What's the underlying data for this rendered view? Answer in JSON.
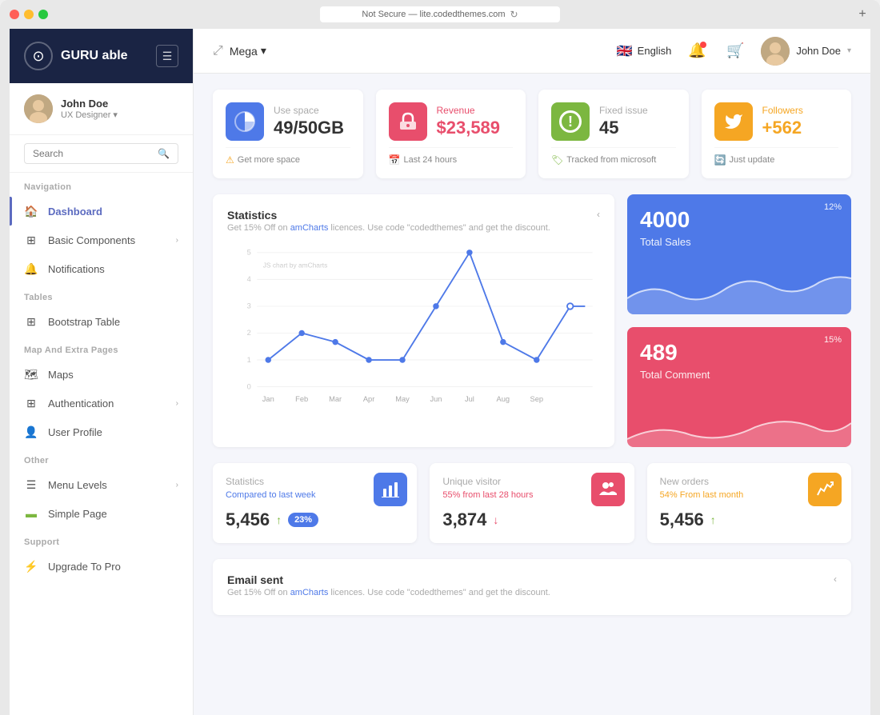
{
  "browser": {
    "url": "Not Secure — lite.codedthemes.com",
    "new_tab_label": "+"
  },
  "sidebar": {
    "logo_text": "GURU able",
    "user_name": "John Doe",
    "user_role": "UX Designer",
    "search_placeholder": "Search",
    "sections": [
      {
        "title": "Navigation",
        "items": [
          {
            "id": "dashboard",
            "label": "Dashboard",
            "icon": "🏠",
            "active": true,
            "has_chevron": false
          },
          {
            "id": "basic-components",
            "label": "Basic Components",
            "icon": "⊞",
            "active": false,
            "has_chevron": true
          },
          {
            "id": "notifications",
            "label": "Notifications",
            "icon": "🔔",
            "active": false,
            "has_chevron": false
          }
        ]
      },
      {
        "title": "Tables",
        "items": [
          {
            "id": "bootstrap-table",
            "label": "Bootstrap Table",
            "icon": "⊞",
            "active": false,
            "has_chevron": false
          }
        ]
      },
      {
        "title": "Map And Extra Pages",
        "items": [
          {
            "id": "maps",
            "label": "Maps",
            "icon": "🗺",
            "active": false,
            "has_chevron": false
          },
          {
            "id": "authentication",
            "label": "Authentication",
            "icon": "⊞",
            "active": false,
            "has_chevron": true
          },
          {
            "id": "user-profile",
            "label": "User Profile",
            "icon": "👤",
            "active": false,
            "has_chevron": false
          }
        ]
      },
      {
        "title": "Other",
        "items": [
          {
            "id": "menu-levels",
            "label": "Menu Levels",
            "icon": "☰",
            "active": false,
            "has_chevron": true
          },
          {
            "id": "simple-page",
            "label": "Simple Page",
            "icon": "▬",
            "active": false,
            "has_chevron": false
          }
        ]
      },
      {
        "title": "Support",
        "items": [
          {
            "id": "upgrade-to-pro",
            "label": "Upgrade To Pro",
            "icon": "⚡",
            "active": false,
            "has_chevron": false
          }
        ]
      }
    ]
  },
  "topbar": {
    "expand_icon": "✕",
    "mega_label": "Mega",
    "language": "English",
    "user_name": "John Doe"
  },
  "stat_cards": [
    {
      "id": "use-space",
      "icon_type": "pie",
      "icon_color": "blue",
      "label": "Use space",
      "value": "49/50GB",
      "value_color": "default",
      "footer_icon": "⚠",
      "footer_text": "Get more space"
    },
    {
      "id": "revenue",
      "icon_type": "home",
      "icon_color": "red",
      "label": "Revenue",
      "value": "$23,589",
      "value_color": "red",
      "footer_icon": "📅",
      "footer_text": "Last 24 hours"
    },
    {
      "id": "fixed-issue",
      "icon_type": "alert",
      "icon_color": "green",
      "label": "Fixed issue",
      "value": "45",
      "value_color": "default",
      "footer_icon": "🏷",
      "footer_text": "Tracked from microsoft"
    },
    {
      "id": "followers",
      "icon_type": "twitter",
      "icon_color": "orange",
      "label": "Followers",
      "value": "+562",
      "value_color": "orange",
      "footer_icon": "🔄",
      "footer_text": "Just update"
    }
  ],
  "statistics_chart": {
    "title": "Statistics",
    "subtitle_prefix": "Get 15% Off on ",
    "subtitle_link": "amCharts",
    "subtitle_suffix": " licences. Use code \"codedthemes\" and get the discount.",
    "collapse_icon": "<",
    "js_chart_label": "JS chart by amCharts",
    "y_labels": [
      "0",
      "1",
      "2",
      "3",
      "4",
      "5"
    ],
    "x_labels": [
      "Jan",
      "Feb",
      "Mar",
      "Apr",
      "May",
      "Jun",
      "Jul",
      "Aug",
      "Sep"
    ]
  },
  "metric_cards": [
    {
      "id": "total-sales",
      "value": "4000",
      "label": "Total Sales",
      "percent": "12%",
      "color": "blue"
    },
    {
      "id": "total-comment",
      "value": "489",
      "label": "Total Comment",
      "percent": "15%",
      "color": "pink"
    }
  ],
  "bottom_stats": [
    {
      "id": "statistics-weekly",
      "title": "Statistics",
      "subtitle": "Compared to last week",
      "subtitle_color": "blue",
      "value": "5,456",
      "trend": "up",
      "badge": "23%",
      "icon_color": "blue"
    },
    {
      "id": "unique-visitor",
      "title": "Unique visitor",
      "subtitle": "55% from last 28 hours",
      "subtitle_color": "red",
      "value": "3,874",
      "trend": "down",
      "badge": null,
      "icon_color": "pink"
    },
    {
      "id": "new-orders",
      "title": "New orders",
      "subtitle": "54% From last month",
      "subtitle_color": "orange",
      "value": "5,456",
      "trend": "up",
      "badge": null,
      "icon_color": "orange"
    }
  ],
  "email_card": {
    "title": "Email sent",
    "subtitle_prefix": "Get 15% Off on ",
    "subtitle_link": "amCharts",
    "subtitle_suffix": " licences. Use code \"codedthemes\" and get the discount.",
    "collapse_icon": "<"
  }
}
